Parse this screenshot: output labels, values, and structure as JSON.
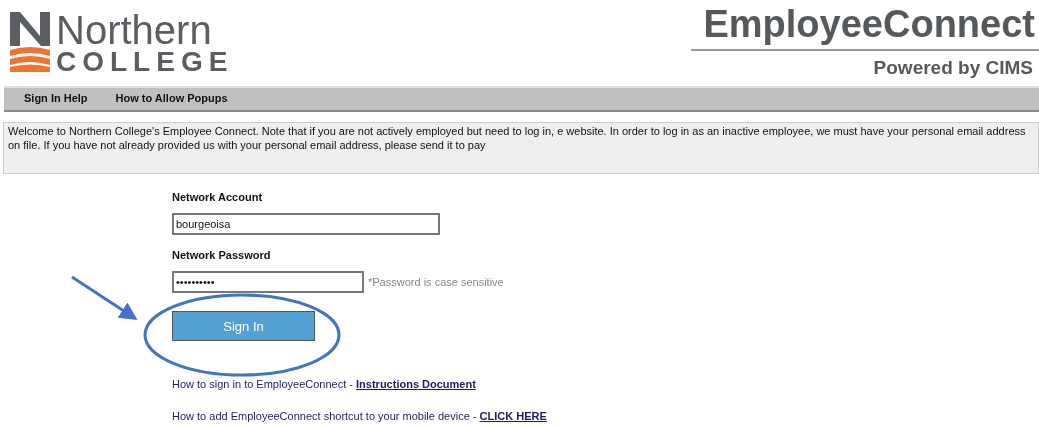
{
  "logo": {
    "line_1": "Northern",
    "line_2": "COLLEGE"
  },
  "brand": {
    "title": "EmployeeConnect",
    "subtitle": "Powered by CIMS"
  },
  "nav": [
    {
      "label": "Sign In Help"
    },
    {
      "label": "How to Allow Popups"
    }
  ],
  "notice": "Welcome to Northern College's Employee Connect. Note that if you are not actively employed but need to log in, e website. In order to log in as an inactive employee, we must have your personal email address on file. If you have not already provided us with your personal email address, please send it to pay",
  "form": {
    "account_label": "Network Account",
    "account_value": "bourgeoisa",
    "password_label": "Network Password",
    "password_value": "••••••••••",
    "password_hint": "*Password is case sensitive",
    "button": "Sign In"
  },
  "links": [
    {
      "text": "How to sign in to EmployeeConnect - ",
      "link": "Instructions Document"
    },
    {
      "text": "How to add EmployeeConnect shortcut to your mobile device - ",
      "link": "CLICK HERE"
    }
  ]
}
